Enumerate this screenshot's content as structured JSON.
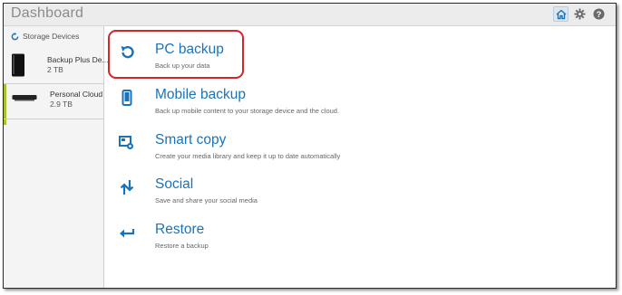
{
  "app": {
    "title": "Dashboard",
    "icons": [
      "home-icon",
      "gear-icon",
      "help-icon"
    ],
    "accent_color": "#1a73b8",
    "highlight_color": "#d4252b"
  },
  "sidebar": {
    "header": "Storage Devices",
    "devices": [
      {
        "name": "Backup Plus De...",
        "size": "2 TB"
      },
      {
        "name": "Personal Cloud",
        "size": "2.9 TB"
      }
    ]
  },
  "main": {
    "items": [
      {
        "title": "PC backup",
        "description": "Back up your data",
        "icon": "backup-icon"
      },
      {
        "title": "Mobile backup",
        "description": "Back up mobile content to your storage device and the cloud.",
        "icon": "mobile-icon"
      },
      {
        "title": "Smart copy",
        "description": "Create your media library and keep it up to date automatically",
        "icon": "smart-copy-icon"
      },
      {
        "title": "Social",
        "description": "Save and share your social media",
        "icon": "social-icon"
      },
      {
        "title": "Restore",
        "description": "Restore a backup",
        "icon": "restore-icon"
      }
    ]
  }
}
